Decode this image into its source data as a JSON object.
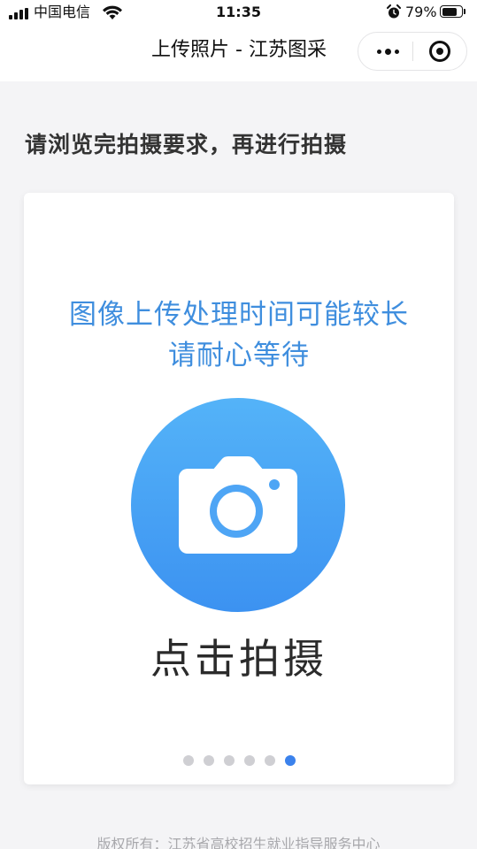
{
  "status_bar": {
    "carrier": "中国电信",
    "time": "11:35",
    "battery": "79%",
    "battery_level": 0.79,
    "icons": [
      "signal-icon",
      "wifi-icon",
      "alarm-icon",
      "battery-icon"
    ]
  },
  "nav": {
    "title": "上传照片 - 江苏图采",
    "more_icon": "more-dots-icon",
    "close_icon": "mini-program-close-icon"
  },
  "instruction": "请浏览完拍摄要求，再进行拍摄",
  "card": {
    "notice_line1": "图像上传处理时间可能较长",
    "notice_line2": "请耐心等待",
    "camera_icon": "camera-icon",
    "action_label": "点击拍摄",
    "pager": {
      "total": 6,
      "active_index": 6
    }
  },
  "footer": "版权所有：江苏省高校招生就业指导服务中心",
  "colors": {
    "accent_blue": "#3f8ede",
    "camera_gradient_top": "#54b3f8",
    "camera_gradient_bottom": "#3c92f1",
    "active_dot": "#3b82ec",
    "inactive_dot": "#cfcfd3",
    "background": "#f4f4f6"
  }
}
